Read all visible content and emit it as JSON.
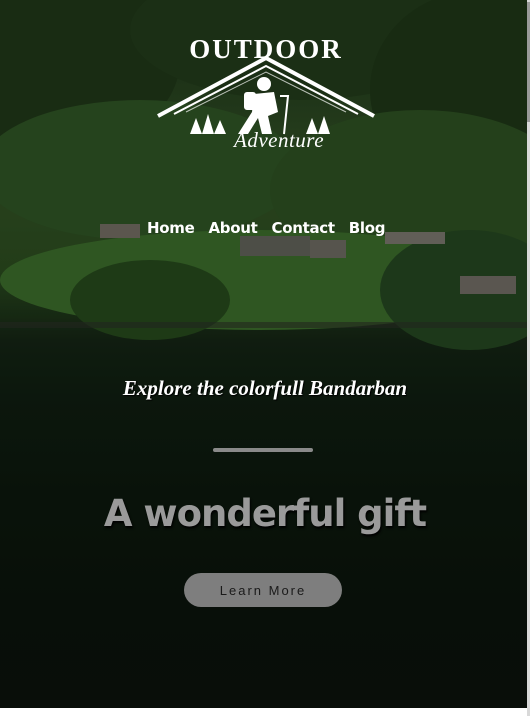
{
  "logo": {
    "top_text": "OUTDOOR",
    "bottom_text": "Adventure"
  },
  "nav": {
    "items": [
      {
        "label": "Home"
      },
      {
        "label": "About"
      },
      {
        "label": "Contact"
      },
      {
        "label": "Blog"
      }
    ]
  },
  "hero": {
    "tagline": "Explore the colorfull Bandarban",
    "headline": "A wonderful gift",
    "cta_label": "Learn More"
  },
  "colors": {
    "text": "#ffffff",
    "headline": "#9a9a9a",
    "button_bg": "#7e7e7e",
    "divider": "#8a8a8a"
  }
}
